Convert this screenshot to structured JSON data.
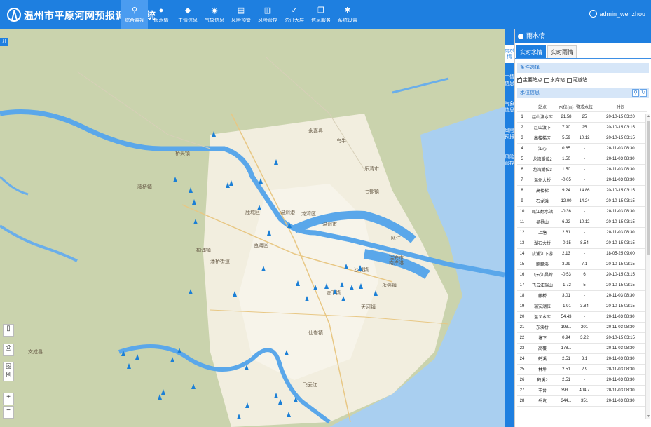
{
  "app": {
    "title": "温州市平原河网预报调度系统",
    "user": "admin_wenzhou",
    "colors": {
      "primary": "#1e7fe0",
      "water": "#5aa7ea",
      "station": "#1b7fd6"
    }
  },
  "nav": [
    {
      "label": "综合监视",
      "icon": "search-icon",
      "glyph": "⚲",
      "active": true
    },
    {
      "label": "雨水情",
      "icon": "drop-icon",
      "glyph": "●",
      "active": false
    },
    {
      "label": "工情信息",
      "icon": "cube-icon",
      "glyph": "◆",
      "active": false
    },
    {
      "label": "气象信息",
      "icon": "globe-icon",
      "glyph": "◉",
      "active": false
    },
    {
      "label": "风险预警",
      "icon": "document-icon",
      "glyph": "▤",
      "active": false
    },
    {
      "label": "风险管控",
      "icon": "people-list-icon",
      "glyph": "▥",
      "active": false
    },
    {
      "label": "防汛大屏",
      "icon": "check-circle-icon",
      "glyph": "✓",
      "active": false
    },
    {
      "label": "信息服务",
      "icon": "copy-icon",
      "glyph": "❐",
      "active": false
    },
    {
      "label": "系统设置",
      "icon": "gear-icon",
      "glyph": "✱",
      "active": false
    }
  ],
  "side_tabs": [
    {
      "label": "雨水情",
      "active": true
    },
    {
      "label": "工情信息",
      "active": false
    },
    {
      "label": "气象信息",
      "active": false
    },
    {
      "label": "风险预报",
      "active": false
    },
    {
      "label": "风险管控",
      "active": false
    }
  ],
  "panel": {
    "header": "雨水情",
    "tabs": [
      {
        "label": "实时水情",
        "active": true
      },
      {
        "label": "实时雨情",
        "active": false
      }
    ],
    "condition_title": "条件选择",
    "filters": [
      {
        "label": "主要站点",
        "checked": true
      },
      {
        "label": "水库站",
        "checked": false
      },
      {
        "label": "河道站",
        "checked": false
      }
    ],
    "water_info_title": "水位信息",
    "columns": [
      "站点",
      "水位(m)",
      "警戒水位",
      "时间"
    ],
    "rows": [
      [
        "1",
        "赵山渡水库",
        "21.58",
        "25",
        "20-10-15 03:20"
      ],
      [
        "2",
        "赵山渡下",
        "7.90",
        "25",
        "20-10-15 03:15"
      ],
      [
        "3",
        "高楼梯区",
        "5.59",
        "10.12",
        "20-10-15 03:15"
      ],
      [
        "4",
        "江心",
        "0.65",
        "-",
        "20-11-03 08:30"
      ],
      [
        "5",
        "龙湾潮位2",
        "1.50",
        "-",
        "20-11-03 08:30"
      ],
      [
        "6",
        "龙湾潮位3",
        "1.50",
        "-",
        "20-11-03 08:30"
      ],
      [
        "7",
        "温州大桥",
        "-0.05",
        "-",
        "20-11-03 08:30"
      ],
      [
        "8",
        "高楼梯",
        "9.24",
        "14.86",
        "20-10-15 03:15"
      ],
      [
        "9",
        "石龙滩",
        "12.00",
        "14.24",
        "20-10-15 03:15"
      ],
      [
        "10",
        "瓯江翻水站",
        "-0.36",
        "-",
        "20-11-03 08:30"
      ],
      [
        "11",
        "吴界山",
        "6.22",
        "10.12",
        "20-10-15 03:15"
      ],
      [
        "12",
        "上塘",
        "2.61",
        "-",
        "20-11-03 08:30"
      ],
      [
        "13",
        "湖石大桥",
        "-0.15",
        "8.54",
        "20-10-15 03:15"
      ],
      [
        "14",
        "戍浦江下游",
        "2.13",
        "-",
        "18-05-25 09:00"
      ],
      [
        "15",
        "麒麟溪",
        "3.99",
        "7.1",
        "20-10-15 03:15"
      ],
      [
        "16",
        "飞云江昌岭",
        "-0.53",
        "6",
        "20-10-15 03:15"
      ],
      [
        "17",
        "飞云江瑞山",
        "-1.72",
        "5",
        "20-10-15 03:15"
      ],
      [
        "18",
        "藤桥",
        "3.01",
        "-",
        "20-11-03 08:30"
      ],
      [
        "19",
        "瑞安潮位",
        "-1.91",
        "3.84",
        "20-10-15 03:15"
      ],
      [
        "20",
        "温义水库",
        "54.43",
        "-",
        "20-11-03 08:30"
      ],
      [
        "21",
        "东溪桥",
        "193...",
        "201",
        "20-11-03 08:30"
      ],
      [
        "22",
        "塘下",
        "0.94",
        "3.22",
        "20-10-15 03:15"
      ],
      [
        "23",
        "高楼",
        "178...",
        "-",
        "20-11-03 08:30"
      ],
      [
        "24",
        "鹤溪",
        "2.51",
        "3.1",
        "20-11-03 08:30"
      ],
      [
        "25",
        "林垟",
        "2.51",
        "2.9",
        "20-11-03 08:30"
      ],
      [
        "26",
        "鹤溪2",
        "2.51",
        "-",
        "20-11-03 08:30"
      ],
      [
        "27",
        "丰台",
        "393...",
        "404.7",
        "20-11-03 08:30"
      ],
      [
        "28",
        "岳坑",
        "344...",
        "351",
        "20-11-03 08:30"
      ]
    ]
  },
  "map": {
    "tools": [
      {
        "icon": "doc-icon",
        "glyph": "▯"
      },
      {
        "icon": "print-icon",
        "glyph": "⎙"
      },
      {
        "icon": "legend-icon",
        "glyph": "图例"
      }
    ],
    "zoom_in": "+",
    "zoom_out": "−",
    "corner_tab": "开",
    "labels": [
      "永嘉县",
      "鹿城区",
      "瓯海区",
      "龙湾区",
      "温州市",
      "乐清市",
      "瑞安市",
      "文成县",
      "温州港",
      "南岸港",
      "沙城镇",
      "天河镇",
      "七都镇",
      "永强镇",
      "仙岩镇",
      "潘桥街道",
      "桐浦镇",
      "藤桥镇",
      "塘下镇",
      "飞云江",
      "瓯江",
      "乌牛",
      "桥头镇"
    ]
  }
}
